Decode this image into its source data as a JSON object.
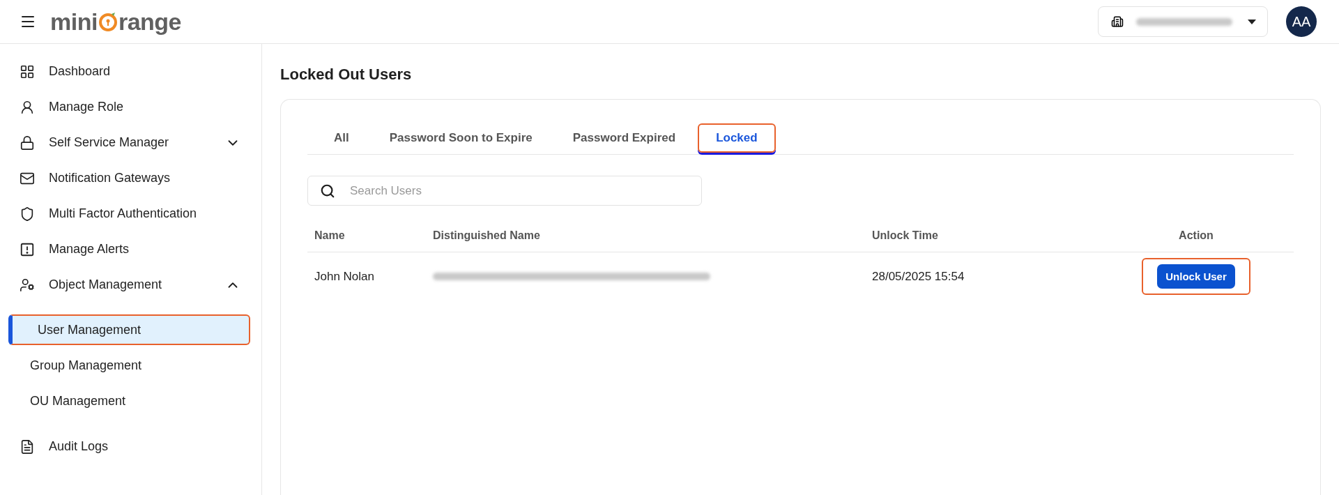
{
  "header": {
    "logo": {
      "before": "mini",
      "after": "range"
    },
    "tenant": {
      "redacted": true
    },
    "avatar": "AA"
  },
  "sidebar": {
    "items": [
      {
        "label": "Dashboard",
        "kind": "link"
      },
      {
        "label": "Manage Role",
        "kind": "link"
      },
      {
        "label": "Self Service Manager",
        "kind": "group",
        "expanded": false
      },
      {
        "label": "Notification Gateways",
        "kind": "link"
      },
      {
        "label": "Multi Factor Authentication",
        "kind": "link"
      },
      {
        "label": "Manage Alerts",
        "kind": "link"
      },
      {
        "label": "Object Management",
        "kind": "group",
        "expanded": true,
        "children": [
          {
            "label": "User Management",
            "selected": true,
            "highlighted": true
          },
          {
            "label": "Group Management",
            "selected": false,
            "highlighted": false
          },
          {
            "label": "OU Management",
            "selected": false,
            "highlighted": false
          }
        ]
      },
      {
        "label": "Audit Logs",
        "kind": "link"
      }
    ]
  },
  "page": {
    "title": "Locked Out Users"
  },
  "tabs": [
    {
      "label": "All",
      "selected": false,
      "highlighted": false
    },
    {
      "label": "Password Soon to Expire",
      "selected": false,
      "highlighted": false
    },
    {
      "label": "Password Expired",
      "selected": false,
      "highlighted": false
    },
    {
      "label": "Locked",
      "selected": true,
      "highlighted": true
    }
  ],
  "search": {
    "placeholder": "Search Users"
  },
  "table": {
    "columns": [
      "Name",
      "Distinguished Name",
      "Unlock Time",
      "Action"
    ],
    "rows": [
      {
        "name": "John Nolan",
        "distinguished_name_redacted": true,
        "unlock_time": "28/05/2025 15:54",
        "action": "Unlock User",
        "highlighted": true
      }
    ]
  }
}
